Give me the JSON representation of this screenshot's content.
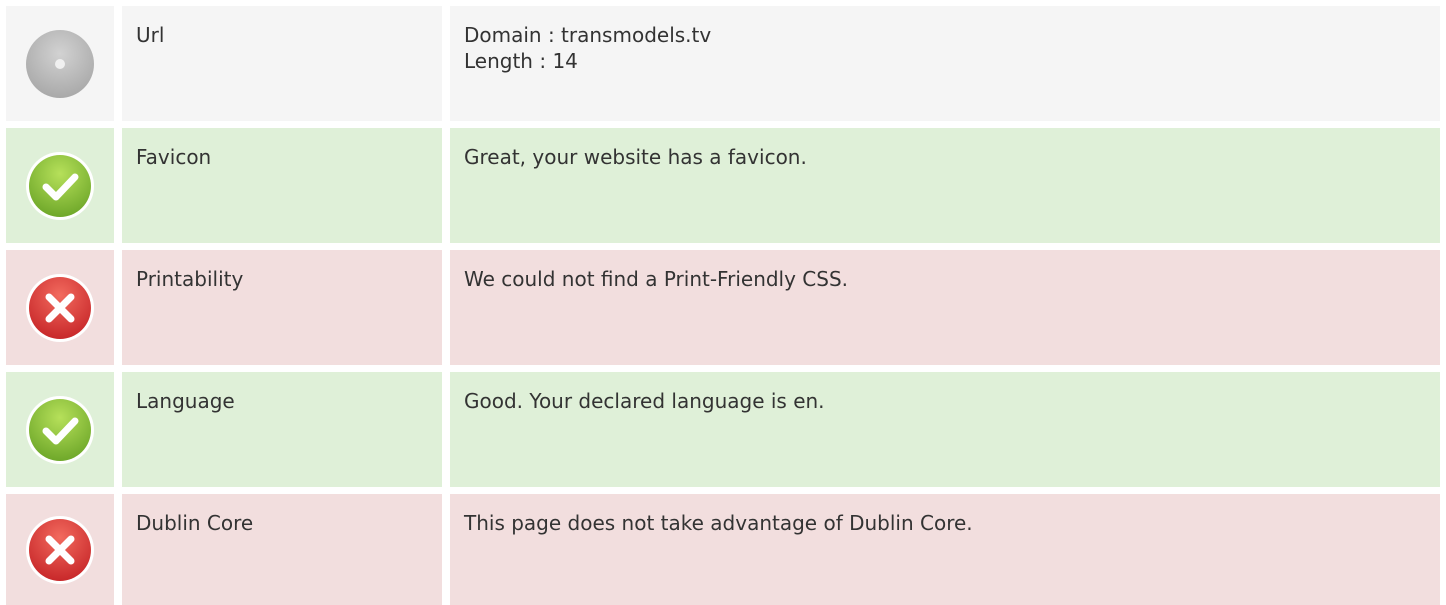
{
  "rows": [
    {
      "status": "neutral",
      "icon": "neutral-disc-icon",
      "label": "Url",
      "value_lines": [
        "Domain : transmodels.tv",
        "Length : 14"
      ]
    },
    {
      "status": "pass",
      "icon": "check-icon",
      "label": "Favicon",
      "value_lines": [
        "Great, your website has a favicon."
      ]
    },
    {
      "status": "fail",
      "icon": "cross-icon",
      "label": "Printability",
      "value_lines": [
        "We could not find a Print-Friendly CSS."
      ]
    },
    {
      "status": "pass",
      "icon": "check-icon",
      "label": "Language",
      "value_lines": [
        "Good. Your declared language is en."
      ]
    },
    {
      "status": "fail",
      "icon": "cross-icon",
      "label": "Dublin Core",
      "value_lines": [
        "This page does not take advantage of Dublin Core."
      ]
    }
  ],
  "colors": {
    "neutral_bg": "#f5f5f5",
    "pass_bg": "#dff0d8",
    "fail_bg": "#f2dede",
    "pass_icon": "#8cc63f",
    "fail_icon": "#e0403a",
    "neutral_icon": "#b7b7b7"
  }
}
